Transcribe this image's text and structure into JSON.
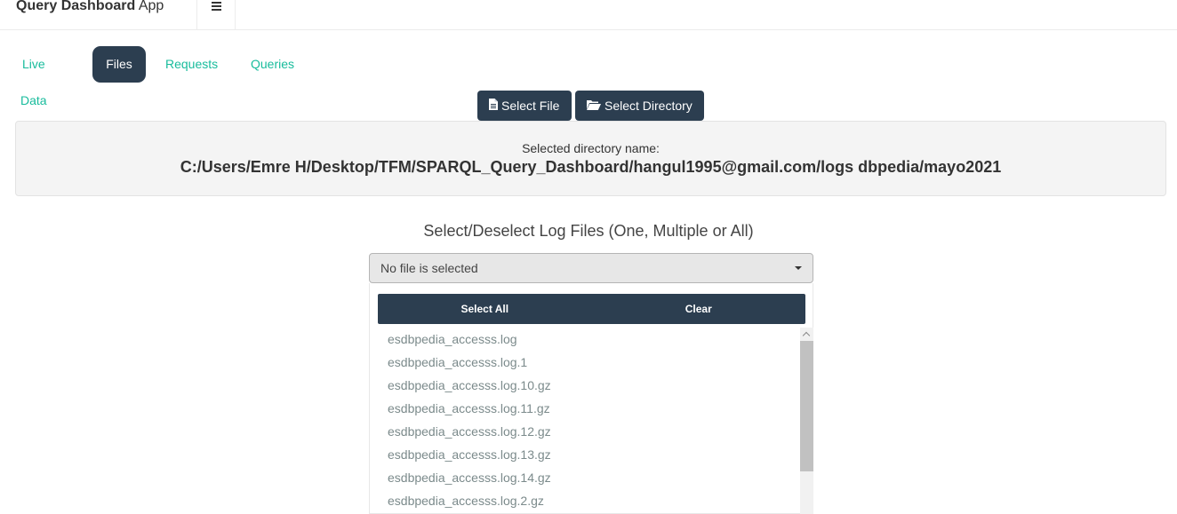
{
  "navbar": {
    "brand_bold": "Query Dashboard",
    "brand_rest": " App",
    "menu_icon": "hamburger-icon"
  },
  "tabs": [
    {
      "label": "Live Data",
      "active": false
    },
    {
      "label": "Files",
      "active": true
    },
    {
      "label": "Requests",
      "active": false
    },
    {
      "label": "Queries",
      "active": false
    }
  ],
  "buttons": {
    "select_file": "Select File",
    "select_file_icon": "file-icon",
    "select_directory": "Select Directory",
    "select_directory_icon": "folder-open-icon"
  },
  "directory": {
    "label": "Selected directory name:",
    "path": "C:/Users/Emre H/Desktop/TFM/SPARQL_Query_Dashboard/hangul1995@gmail.com/logs dbpedia/mayo2021"
  },
  "log_files": {
    "title": "Select/Deselect Log Files (One, Multiple or All)",
    "picker_value": "No file is selected",
    "select_all": "Select All",
    "clear": "Clear",
    "items": [
      "esdbpedia_accesss.log",
      "esdbpedia_accesss.log.1",
      "esdbpedia_accesss.log.10.gz",
      "esdbpedia_accesss.log.11.gz",
      "esdbpedia_accesss.log.12.gz",
      "esdbpedia_accesss.log.13.gz",
      "esdbpedia_accesss.log.14.gz",
      "esdbpedia_accesss.log.2.gz"
    ]
  },
  "colors": {
    "primary": "#2c3e50",
    "accent": "#18bc9c",
    "well_bg": "#f4f4f4"
  }
}
